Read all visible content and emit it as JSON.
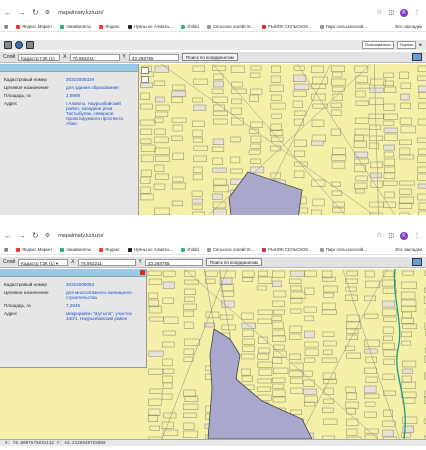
{
  "browser": {
    "url": "mapalmaty.kz/uzo/",
    "profile_initial": "K",
    "bookmarks": [
      "Яндекс Маркет",
      "АвиаБилеты",
      "Яндекс",
      "Нуяны не Алматы...",
      "zhddd",
      "Сельское хозяйств...",
      "РЫНОК СЕЛЬСКОХ...",
      "Парк сельскохозяй..."
    ],
    "other_bookmarks": "Все закладки"
  },
  "auth": {
    "user_label": "Пользователь",
    "password_label": "Пароль"
  },
  "controls": {
    "layer_label": "Слой",
    "layer_value": "Кадастр ГЗК (1)",
    "x_label": "X",
    "x_value": "76.953211",
    "y_label": "Y",
    "y_value": "43.258765",
    "search_button": "Поиск по координатам"
  },
  "panel1": {
    "rows": [
      {
        "k": "Кадастровый номер",
        "v": "20322008329"
      },
      {
        "k": "Целевое назначение",
        "v": "для здания образования"
      },
      {
        "k": "Площадь, га",
        "v": "2,9999"
      },
      {
        "k": "Адрес",
        "v": "г.Алматы, Наурызбайский район, западнее реки Тастыбулак, северное проектируемого проспекта Абая"
      }
    ]
  },
  "panel2": {
    "rows": [
      {
        "k": "Кадастровый номер",
        "v": "20322008063"
      },
      {
        "k": "Целевое назначение",
        "v": "для многоэтажного жилищного строительства"
      },
      {
        "k": "Площадь, га",
        "v": "7,2945"
      },
      {
        "k": "Адрес",
        "v": "микрорайон \"Шугыла\", участок 340/1, Наурызбайский район"
      }
    ]
  },
  "status_bar": "X: 76.8007575031112   Y: 43.2126040725958",
  "colors": {
    "map_bg": "#f4f0a7",
    "parcel_line": "#5a5a5a",
    "highlight": "#a9a8cc",
    "panel_header": "#9cc8e8",
    "link": "#1b4fd1"
  }
}
